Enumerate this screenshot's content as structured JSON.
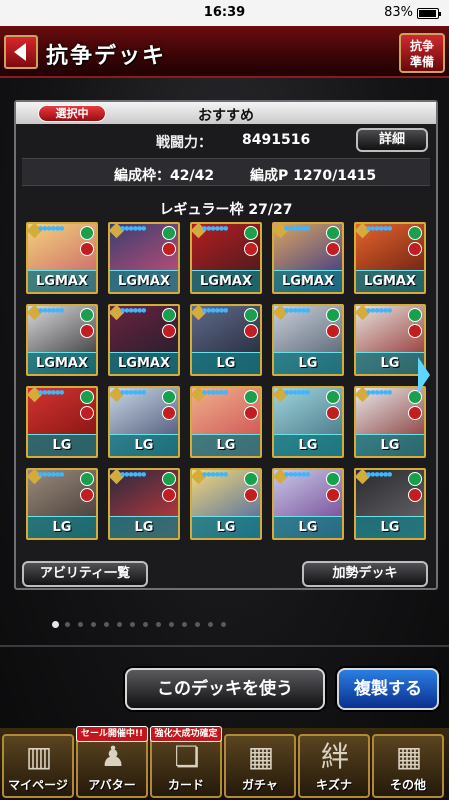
{
  "status_bar": {
    "time": "16:39",
    "battery": "83%",
    "battery_level": 0.83
  },
  "header": {
    "title": "抗争デッキ",
    "prep_line1": "抗争",
    "prep_line2": "準備"
  },
  "deck": {
    "selected_badge": "選択中",
    "name": "おすすめ",
    "power_label": "戦闘力：",
    "power_value": "8491516",
    "detail_button": "詳細",
    "slots_text": "編成枠：42/42",
    "cost_text": "編成P 1270/1415",
    "regular_label": "レギュラー枠 27/27",
    "cards": [
      {
        "label": "LGMAX",
        "colors": [
          "#f2d27a",
          "#c85a6a"
        ]
      },
      {
        "label": "LGMAX",
        "colors": [
          "#3a3f6e",
          "#d04f7a"
        ]
      },
      {
        "label": "LGMAX",
        "colors": [
          "#b51d22",
          "#3a1c1c"
        ]
      },
      {
        "label": "LGMAX",
        "colors": [
          "#d9a460",
          "#2d2f8a"
        ]
      },
      {
        "label": "LGMAX",
        "colors": [
          "#e5642a",
          "#5a1712"
        ]
      },
      {
        "label": "LGMAX",
        "colors": [
          "#d8d8dc",
          "#262628"
        ]
      },
      {
        "label": "LGMAX",
        "colors": [
          "#6a2340",
          "#1d1d2a"
        ]
      },
      {
        "label": "LG",
        "colors": [
          "#5f6a8a",
          "#1f2333"
        ]
      },
      {
        "label": "LG",
        "colors": [
          "#c7cfd8",
          "#4a5568"
        ]
      },
      {
        "label": "LG",
        "colors": [
          "#e6e2dc",
          "#8a1f1f"
        ]
      },
      {
        "label": "LG",
        "colors": [
          "#d2342f",
          "#7a1010"
        ]
      },
      {
        "label": "LG",
        "colors": [
          "#c9d4e4",
          "#3a4868"
        ]
      },
      {
        "label": "LG",
        "colors": [
          "#f0b08a",
          "#c8464f"
        ]
      },
      {
        "label": "LG",
        "colors": [
          "#9fd4dc",
          "#3a6a7a"
        ]
      },
      {
        "label": "LG",
        "colors": [
          "#e9e9e9",
          "#7a2424"
        ]
      },
      {
        "label": "LG",
        "colors": [
          "#9a8a7a",
          "#3a3230"
        ]
      },
      {
        "label": "LG",
        "colors": [
          "#2a2a40",
          "#d03a3a"
        ]
      },
      {
        "label": "LG",
        "colors": [
          "#f2d87a",
          "#3a5ea8"
        ]
      },
      {
        "label": "LG",
        "colors": [
          "#c8c8e8",
          "#6a3a8a"
        ]
      },
      {
        "label": "LG",
        "colors": [
          "#2a2a2e",
          "#6a6a70"
        ]
      }
    ],
    "ability_button": "アビリティ一覧",
    "support_button": "加勢デッキ"
  },
  "pager": {
    "count": 14,
    "active_index": 0
  },
  "actions": {
    "use_deck": "このデッキを使う",
    "copy": "複製する"
  },
  "nav": {
    "items": [
      {
        "label": "マイページ",
        "icon": "building-icon",
        "glyph": "▥"
      },
      {
        "label": "アバター",
        "icon": "avatar-icon",
        "glyph": "♟",
        "tag": "セール開催中!!"
      },
      {
        "label": "カード",
        "icon": "card-icon",
        "glyph": "❏",
        "tag": "強化大成功確定"
      },
      {
        "label": "ガチャ",
        "icon": "gacha-icon",
        "glyph": "▦"
      },
      {
        "label": "キズナ",
        "icon": "bond-icon",
        "glyph": "絆"
      },
      {
        "label": "その他",
        "icon": "grid-icon",
        "glyph": "▦"
      }
    ]
  }
}
